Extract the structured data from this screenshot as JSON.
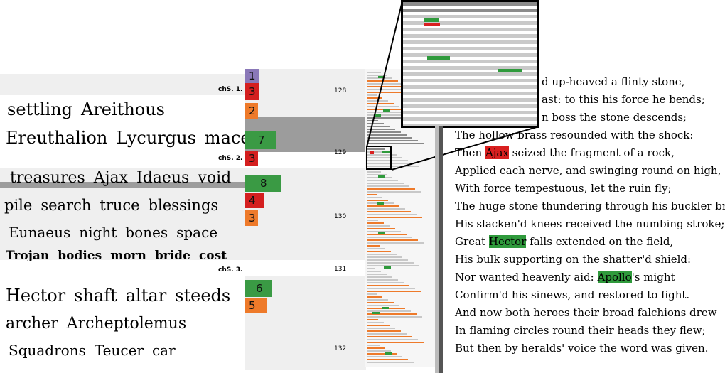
{
  "keyword_rows": [
    {
      "words": [
        "settling",
        "Areithous"
      ],
      "band": "light"
    },
    {
      "words": [
        "Ereuthalion",
        "Lycurgus",
        "mace"
      ],
      "band": "dark"
    },
    {
      "words": [
        "treasures",
        "Ajax",
        "Idaeus",
        "void"
      ],
      "band": "light"
    },
    {
      "words": [
        "pile",
        "search",
        "truce",
        "blessings"
      ],
      "band": "light"
    },
    {
      "words": [
        "Eunaeus",
        "night",
        "bones",
        "space"
      ],
      "band": "light"
    },
    {
      "words": [
        "Trojan",
        "bodies",
        "morn",
        "bride",
        "cost"
      ],
      "band": "light"
    },
    {
      "words": [
        "Hector",
        "shaft",
        "altar",
        "steeds"
      ],
      "band": "none"
    },
    {
      "words": [
        "archer",
        "Archeptolemus"
      ],
      "band": "none"
    },
    {
      "words": [
        "Squadrons",
        "Teucer",
        "car"
      ],
      "band": "none"
    }
  ],
  "chapters": [
    {
      "label": "chS. 1.",
      "page": "128"
    },
    {
      "label": "chS. 2.",
      "page": "129"
    },
    {
      "label": "",
      "page": "130"
    },
    {
      "label": "chS. 3.",
      "page": "131"
    },
    {
      "label": "",
      "page": "132"
    }
  ],
  "topic_boxes": [
    {
      "num": "1",
      "color": "#8a78b8"
    },
    {
      "num": "3",
      "color": "#d41f1f"
    },
    {
      "num": "2",
      "color": "#ee7a2a"
    },
    {
      "num": "7",
      "color": "#3a9a44"
    },
    {
      "num": "3",
      "color": "#d41f1f"
    },
    {
      "num": "8",
      "color": "#3a9a44"
    },
    {
      "num": "4",
      "color": "#d41f1f"
    },
    {
      "num": "3",
      "color": "#ee7a2a"
    },
    {
      "num": "6",
      "color": "#3a9a44"
    },
    {
      "num": "5",
      "color": "#ee7a2a"
    }
  ],
  "poem_lines": [
    {
      "pre": "d up-heaved a flinty stone,",
      "hl": "",
      "post": "",
      "hlcolor": ""
    },
    {
      "pre": "ast: to this his force he bends;",
      "hl": "",
      "post": "",
      "hlcolor": ""
    },
    {
      "pre": "n boss the stone descends;",
      "hl": "",
      "post": "",
      "hlcolor": ""
    },
    {
      "pre": "The hollow brass resounded with the shock:",
      "hl": "",
      "post": "",
      "hlcolor": ""
    },
    {
      "pre": "Then ",
      "hl": "Ajax",
      "post": " seized the fragment of a rock,",
      "hlcolor": "red"
    },
    {
      "pre": "Applied each nerve, and swinging round on high,",
      "hl": "",
      "post": "",
      "hlcolor": ""
    },
    {
      "pre": "With force tempestuous, let the ruin fly;",
      "hl": "",
      "post": "",
      "hlcolor": ""
    },
    {
      "pre": "The huge stone thundering through his buckler broke:",
      "hl": "",
      "post": "",
      "hlcolor": ""
    },
    {
      "pre": "His slacken'd knees received the numbing stroke;",
      "hl": "",
      "post": "",
      "hlcolor": ""
    },
    {
      "pre": "Great ",
      "hl": "Hector",
      "post": " falls extended on the field,",
      "hlcolor": "green"
    },
    {
      "pre": "His bulk supporting on the shatter'd shield:",
      "hl": "",
      "post": "",
      "hlcolor": ""
    },
    {
      "pre": "Nor wanted heavenly aid: ",
      "hl": "Apollo",
      "post": "'s might",
      "hlcolor": "green"
    },
    {
      "pre": "Confirm'd his sinews, and restored to fight.",
      "hl": "",
      "post": "",
      "hlcolor": ""
    },
    {
      "pre": "And now both heroes their broad falchions drew",
      "hl": "",
      "post": "",
      "hlcolor": ""
    },
    {
      "pre": "In flaming circles round their heads they flew;",
      "hl": "",
      "post": "",
      "hlcolor": ""
    },
    {
      "pre": "But then by heralds' voice the word was given.",
      "hl": "",
      "post": "",
      "hlcolor": ""
    }
  ],
  "colors": {
    "green": "#2f9a3c",
    "red": "#d92020",
    "orange": "#ee7a2a",
    "purple": "#8a78b8",
    "band_light": "#eeeeee",
    "band_dark": "#9c9c9c"
  }
}
